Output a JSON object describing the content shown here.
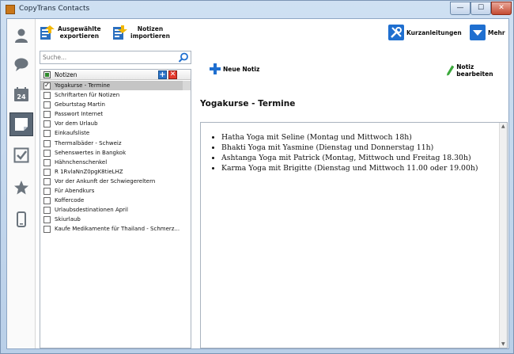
{
  "window": {
    "title": "CopyTrans Contacts",
    "minimize_glyph": "—",
    "maximize_glyph": "☐",
    "close_glyph": "✕"
  },
  "leftnav": {
    "items": [
      {
        "name": "contacts",
        "icon": "person-icon"
      },
      {
        "name": "messages",
        "icon": "speech-bubble-icon"
      },
      {
        "name": "calendar",
        "icon": "calendar-icon",
        "label": "24"
      },
      {
        "name": "notes",
        "icon": "note-icon",
        "active": true
      },
      {
        "name": "tasks",
        "icon": "checkbox-icon"
      },
      {
        "name": "favorites",
        "icon": "star-icon"
      },
      {
        "name": "device",
        "icon": "phone-icon"
      }
    ]
  },
  "toolbar": {
    "export_label_1": "Ausgewählte",
    "export_label_2": "exportieren",
    "import_label_1": "Notizen",
    "import_label_2": "importieren",
    "help_label": "Kurzanleitungen",
    "more_label": "Mehr"
  },
  "search": {
    "placeholder": "Suche..."
  },
  "notes_panel": {
    "header_label": "Notizen",
    "items": [
      {
        "title": "Yogakurse - Termine",
        "checked": true,
        "selected": true
      },
      {
        "title": "Schriftarten für Notizen",
        "checked": false
      },
      {
        "title": "Geburtstag Martin",
        "checked": false
      },
      {
        "title": "Passwort Internet",
        "checked": false
      },
      {
        "title": "Vor dem Urlaub",
        "checked": false
      },
      {
        "title": "Einkaufsliste",
        "checked": false
      },
      {
        "title": "Thermalbäder - Schweiz",
        "checked": false
      },
      {
        "title": "Sehenswertes in Bangkok",
        "checked": false
      },
      {
        "title": "Hähnchenschenkel",
        "checked": false
      },
      {
        "title": "R 1RvlaNnZ0pgK8tieLHZ",
        "checked": false
      },
      {
        "title": "Vor der Ankunft der Schwiegereltern",
        "checked": false
      },
      {
        "title": "Für Abendkurs",
        "checked": false
      },
      {
        "title": "Koffercode",
        "checked": false
      },
      {
        "title": "Urlaubsdestinationen April",
        "checked": false
      },
      {
        "title": "Skiurlaub",
        "checked": false
      },
      {
        "title": "Kaufe Medikamente für Thailand - Schmerz...",
        "checked": false
      }
    ]
  },
  "actions": {
    "new_note": "Neue Notiz",
    "edit_note": "Notiz bearbeiten"
  },
  "note": {
    "title": "Yogakurse - Termine",
    "lines": [
      "Hatha Yoga mit Seline (Montag und Mittwoch 18h)",
      "Bhakti Yoga mit Yasmine (Dienstag und Donnerstag 11h)",
      "Ashtanga Yoga mit Patrick (Montag, Mittwoch und Freitag 18.30h)",
      "Karma Yoga mit Brigitte (Dienstag und Mittwoch 11.00 oder 19.00h)"
    ]
  },
  "colors": {
    "accent_blue": "#1f6fd0",
    "delete_red": "#e43a2d",
    "check_green": "#2f8a2c",
    "nav_active": "#5b6876"
  }
}
